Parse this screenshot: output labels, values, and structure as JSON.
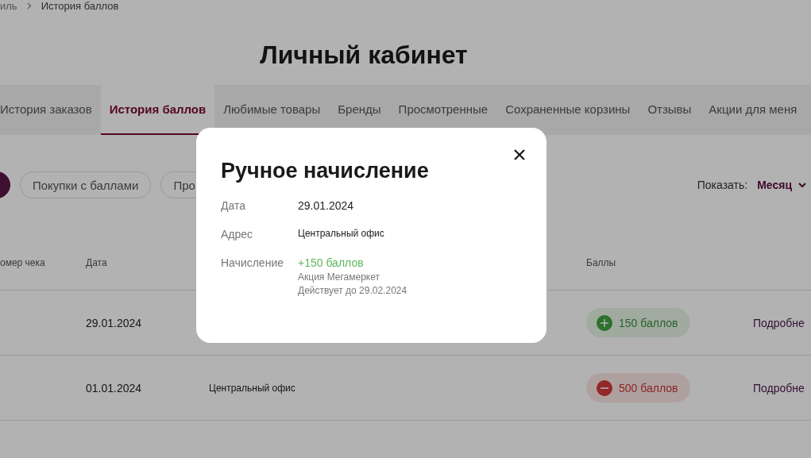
{
  "breadcrumbs": [
    "иль",
    "История баллов"
  ],
  "page_title": "Личный кабинет",
  "tabs": [
    {
      "label": "История заказов",
      "selected": false
    },
    {
      "label": "История баллов",
      "selected": true
    },
    {
      "label": "Любимые товары",
      "selected": false
    },
    {
      "label": "Бренды",
      "selected": false
    },
    {
      "label": "Просмотренные",
      "selected": false
    },
    {
      "label": "Сохраненные корзины",
      "selected": false
    },
    {
      "label": "Отзывы",
      "selected": false
    },
    {
      "label": "Акции для меня",
      "selected": false
    }
  ],
  "filters": [
    {
      "selected": true
    },
    {
      "label": "Покупки с баллами",
      "selected": false
    },
    {
      "label": "Про",
      "selected": false
    }
  ],
  "period": {
    "label": "Показать:",
    "value": "Месяц"
  },
  "table": {
    "columns": [
      "омер чека",
      "Дата",
      "",
      "Баллы",
      ""
    ],
    "rows": [
      {
        "date": "29.01.2024",
        "address": "",
        "points": "150 баллов",
        "kind": "plus",
        "details": "Подробне"
      },
      {
        "date": "01.01.2024",
        "address": "Центральный офис",
        "points": "500 баллов",
        "kind": "minus",
        "details": "Подробне"
      }
    ]
  },
  "modal": {
    "title": "Ручное начисление",
    "fields": [
      {
        "label": "Дата",
        "value": "29.01.2024",
        "kind": "plain"
      },
      {
        "label": "Адрес",
        "value": "Центральный офис",
        "kind": "small"
      },
      {
        "label": "Начисление",
        "value": "+150 баллов",
        "kind": "accrual",
        "notes": [
          "Акция Мегамеркет",
          "Действует до 29.02.2024"
        ]
      }
    ]
  }
}
